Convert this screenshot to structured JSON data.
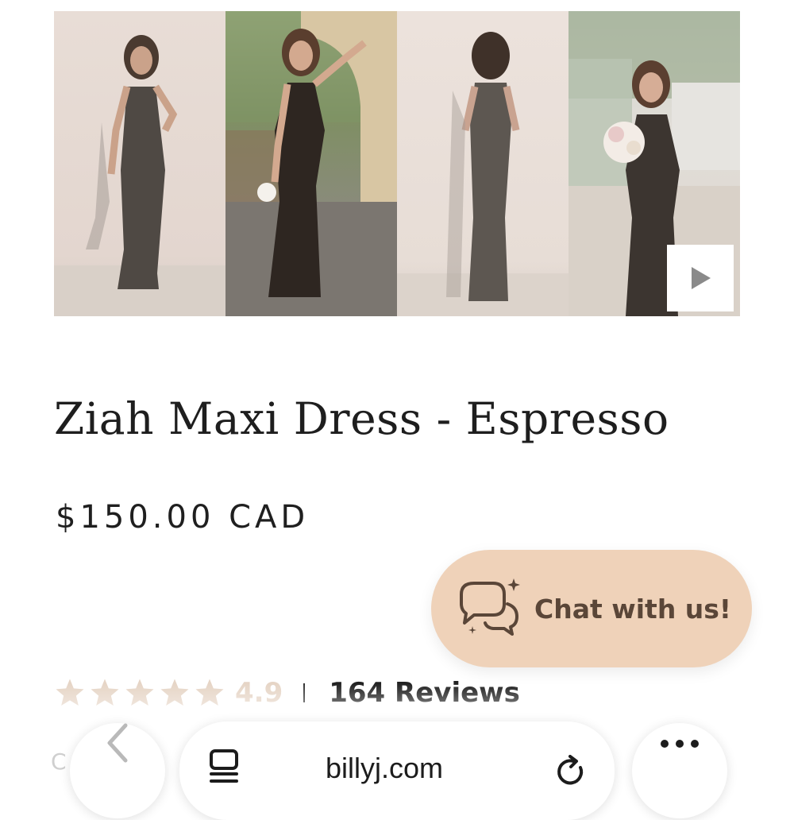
{
  "gallery": {
    "photos": [
      "product-photo-front",
      "product-photo-arch",
      "product-photo-back",
      "product-photo-bouquet"
    ],
    "video_button_icon": "play-icon"
  },
  "product": {
    "title": "Ziah Maxi Dress - Espresso",
    "price": "$150.00 CAD"
  },
  "chat": {
    "label": "Chat with us!",
    "icon": "chat-bubbles-icon",
    "color": "#efd2b9"
  },
  "rating": {
    "stars": 5,
    "value": "4.9",
    "separator": "|",
    "reviews": "164 Reviews",
    "star_color": "#e6d5c6"
  },
  "browser": {
    "url": "billyj.com",
    "ghost_text": "C",
    "back_icon": "chevron-left-icon",
    "reader_icon": "reader-mode-icon",
    "reload_icon": "reload-icon",
    "more_icon": "more-icon"
  }
}
